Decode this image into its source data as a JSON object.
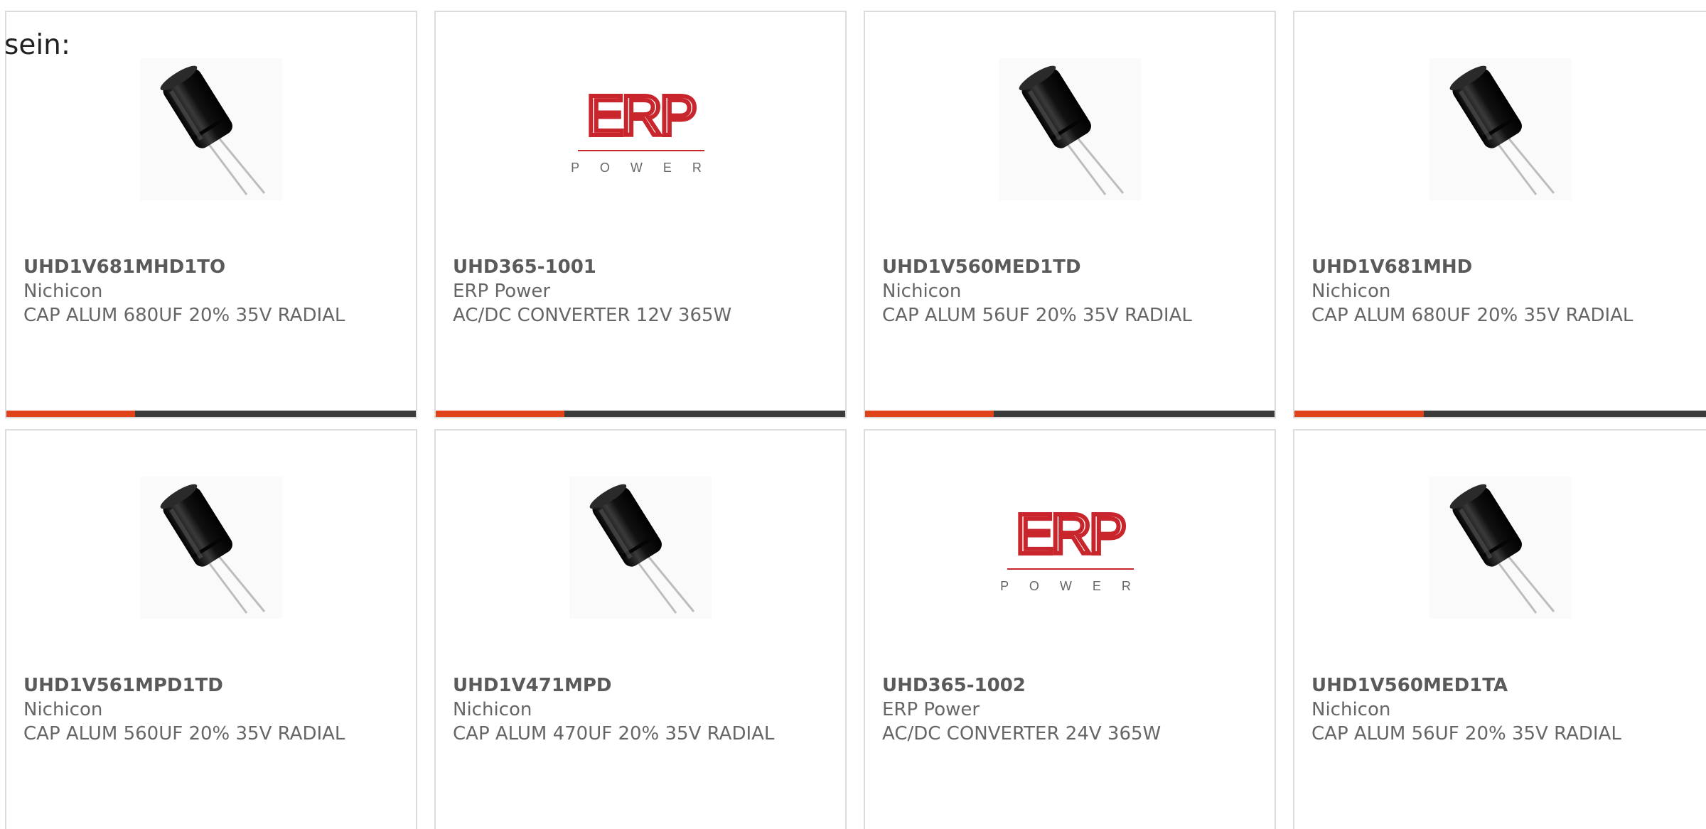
{
  "intro_text": "sein:",
  "colors": {
    "accent": "#e0421a",
    "bar_dark": "#3b3b3b",
    "text": "#666666",
    "border": "#dcdcdc",
    "erp_red": "#c8252c"
  },
  "products": [
    {
      "part_number": "UHD1V681MHD1TO",
      "manufacturer": "Nichicon",
      "description": "CAP ALUM 680UF 20% 35V RADIAL",
      "image": "capacitor",
      "bar_fill": 0.315
    },
    {
      "part_number": "UHD365-1001",
      "manufacturer": "ERP Power",
      "description": "AC/DC CONVERTER 12V 365W",
      "image": "erp-power-logo",
      "logo_text": "ERP",
      "logo_subtext": "POWER",
      "bar_fill": 0.315
    },
    {
      "part_number": "UHD1V560MED1TD",
      "manufacturer": "Nichicon",
      "description": "CAP ALUM 56UF 20% 35V RADIAL",
      "image": "capacitor",
      "bar_fill": 0.315
    },
    {
      "part_number": "UHD1V681MHD",
      "manufacturer": "Nichicon",
      "description": "CAP ALUM 680UF 20% 35V RADIAL",
      "image": "capacitor",
      "bar_fill": 0.315
    },
    {
      "part_number": "UHD1V561MPD1TD",
      "manufacturer": "Nichicon",
      "description": "CAP ALUM 560UF 20% 35V RADIAL",
      "image": "capacitor"
    },
    {
      "part_number": "UHD1V471MPD",
      "manufacturer": "Nichicon",
      "description": "CAP ALUM 470UF 20% 35V RADIAL",
      "image": "capacitor"
    },
    {
      "part_number": "UHD365-1002",
      "manufacturer": "ERP Power",
      "description": "AC/DC CONVERTER 24V 365W",
      "image": "erp-power-logo",
      "logo_text": "ERP",
      "logo_subtext": "POWER"
    },
    {
      "part_number": "UHD1V560MED1TA",
      "manufacturer": "Nichicon",
      "description": "CAP ALUM 56UF 20% 35V RADIAL",
      "image": "capacitor"
    }
  ]
}
